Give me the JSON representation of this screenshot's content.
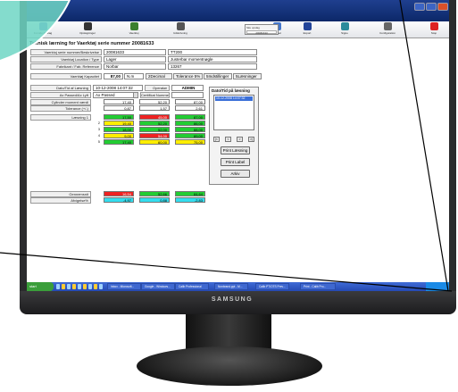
{
  "window": {
    "title": ""
  },
  "toolbar": {
    "items": [
      {
        "label": "Forside  Opslag",
        "color": "#6a8fd0"
      },
      {
        "label": "Opslagninger",
        "color": "#333333"
      },
      {
        "label": "Vaerktoj",
        "color": "#3a7f2e"
      },
      {
        "label": "Udskrivning",
        "color": "#555555"
      },
      {
        "label": "Indsaet",
        "color": "#4477cc"
      },
      {
        "label": "Export",
        "color": "#224499"
      },
      {
        "label": "Signe",
        "color": "#2a8a9a"
      },
      {
        "label": "Configuration",
        "color": "#666666"
      },
      {
        "label": "Stop",
        "color": "#dd2222"
      }
    ],
    "search": {
      "label": "Sku opslag",
      "value": "20081633"
    }
  },
  "heading": "Teknisk lærning for Vaerktøj serie nummer 20081633",
  "fields": [
    {
      "label": "Vaerktoj serie nummer/Beskrivelse",
      "value": "20081633",
      "value2": "TT200"
    },
    {
      "label": "Vaerktøj Location / Type",
      "value": "Lager",
      "value2": "Justerbar momentnøgle"
    },
    {
      "label": "Fabrikant / Fab. Reference",
      "value": "Norbar",
      "value2": "13267"
    }
  ],
  "capacity": {
    "label": "Vaerktøj Kapacitet",
    "value": "87,00",
    "unit": "N.m",
    "decimals": "2Decimal",
    "tolerance": "Tolerance 5%",
    "positions": "5Indstillinger",
    "readings": "5Læsninger"
  },
  "date_row": {
    "label": "Dato/Tid af Læsning",
    "value": "10-12-2008 14:07:32",
    "operator_label": "Operatør",
    "operator": "ADMIN"
  },
  "pass_row": {
    "label": "Ax Passed/Ax Lyft",
    "value": "Ax Passed",
    "cert_label": "Certifikat Nummer",
    "cert": ""
  },
  "target_row": {
    "label": "Cylinder moment værdi",
    "values": [
      "17,40",
      "52,20",
      "87,00"
    ]
  },
  "tol_row": {
    "label": "Tolerance  (+/-)",
    "values": [
      "0,87",
      "1,57",
      "2,61"
    ]
  },
  "readings": {
    "label": "Læsning 1",
    "rows": [
      {
        "idx": "",
        "values": [
          "17,50",
          "45,00",
          "87,00"
        ],
        "colors": [
          "g",
          "r",
          "g"
        ]
      },
      {
        "idx": "2",
        "values": [
          "19,40",
          "52,20",
          "86,00"
        ],
        "colors": [
          "y",
          "g",
          "g"
        ]
      },
      {
        "idx": "3",
        "values": [
          "18,00",
          "52,00",
          "88,00"
        ],
        "colors": [
          "g",
          "g",
          "g"
        ]
      },
      {
        "idx": "4",
        "values": [
          "9,00",
          "54,00",
          "89,00"
        ],
        "colors": [
          "y",
          "r",
          "g"
        ]
      },
      {
        "idx": "5",
        "values": [
          "17,40",
          "60,00",
          "75,00"
        ],
        "colors": [
          "g",
          "y",
          "y"
        ]
      }
    ]
  },
  "summary": {
    "rows": [
      {
        "label": "Gennemsnit",
        "values": [
          "16,54",
          "52,66",
          "84,64"
        ],
        "colors": [
          "r",
          "g",
          "g"
        ]
      },
      {
        "label": "Afvigelse%",
        "values": [
          "-4,97",
          "0,88",
          "-2,83"
        ],
        "colors": [
          "c",
          "c",
          "c"
        ]
      }
    ]
  },
  "history": {
    "title": "Dato/Tid på læsning",
    "selected": "10-12-2008 14:07:32",
    "nav": [
      "|<",
      "<",
      ">",
      ">|"
    ],
    "buttons": [
      "Print Læsning",
      "Print Label",
      "Arkiv"
    ]
  },
  "taskbar": {
    "start": "start",
    "tasks": [
      "Inbox - Microsoft...",
      "Google - Windows...",
      "Calib Professional",
      "Nonbrand.ppt - M...",
      "Calib PT/OTS Prev...",
      "Print - Calib Pro..."
    ]
  },
  "monitor": {
    "brand": "SAMSUNG"
  },
  "colors": {
    "red": "#ee2222",
    "yellow": "#ffee00",
    "green": "#22cc33",
    "cyan": "#33ddee",
    "titlebar": "#1f3f8f"
  }
}
